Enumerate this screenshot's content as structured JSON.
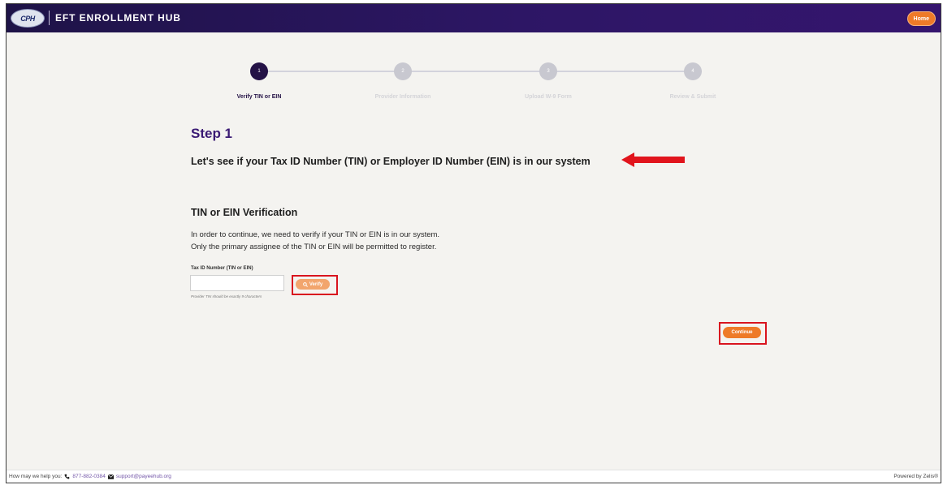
{
  "header": {
    "logo_text": "CPH",
    "app_title": "EFT ENROLLMENT HUB",
    "home_label": "Home"
  },
  "stepper": {
    "steps": [
      {
        "number": "1",
        "label": "Verify TIN or EIN",
        "active": true
      },
      {
        "number": "2",
        "label": "Provider Information",
        "active": false
      },
      {
        "number": "3",
        "label": "Upload W-9 Form",
        "active": false
      },
      {
        "number": "4",
        "label": "Review & Submit",
        "active": false
      }
    ]
  },
  "main": {
    "step_heading": "Step 1",
    "subheading": "Let's see if your Tax ID Number (TIN) or Employer ID Number (EIN) is in our system",
    "section_title": "TIN or EIN Verification",
    "paragraph_1": "In order to continue, we need to verify if your TIN or EIN is in our system.",
    "paragraph_2": "Only the primary assignee of the TIN or EIN will be permitted to register.",
    "tin_field": {
      "label": "Tax ID Number (TIN or EIN)",
      "value": "",
      "placeholder": "",
      "hint": "Provider TIN should be exactly 9 characters"
    },
    "verify_label": "Verify",
    "continue_label": "Continue"
  },
  "footer": {
    "help_text": "How may we help you:",
    "phone": "877-882-0384",
    "email": "support@payeehub.org",
    "powered_by": "Powered by Zelis®"
  },
  "colors": {
    "header": "#2d1665",
    "accent_orange": "#ee7a28",
    "step_active": "#241246",
    "step_heading": "#3a1a74",
    "annotation_red": "#d9141f"
  },
  "icons": {
    "verify": "search-icon",
    "phone": "phone-icon",
    "email": "envelope-icon",
    "annotation": "arrow-left-icon"
  }
}
